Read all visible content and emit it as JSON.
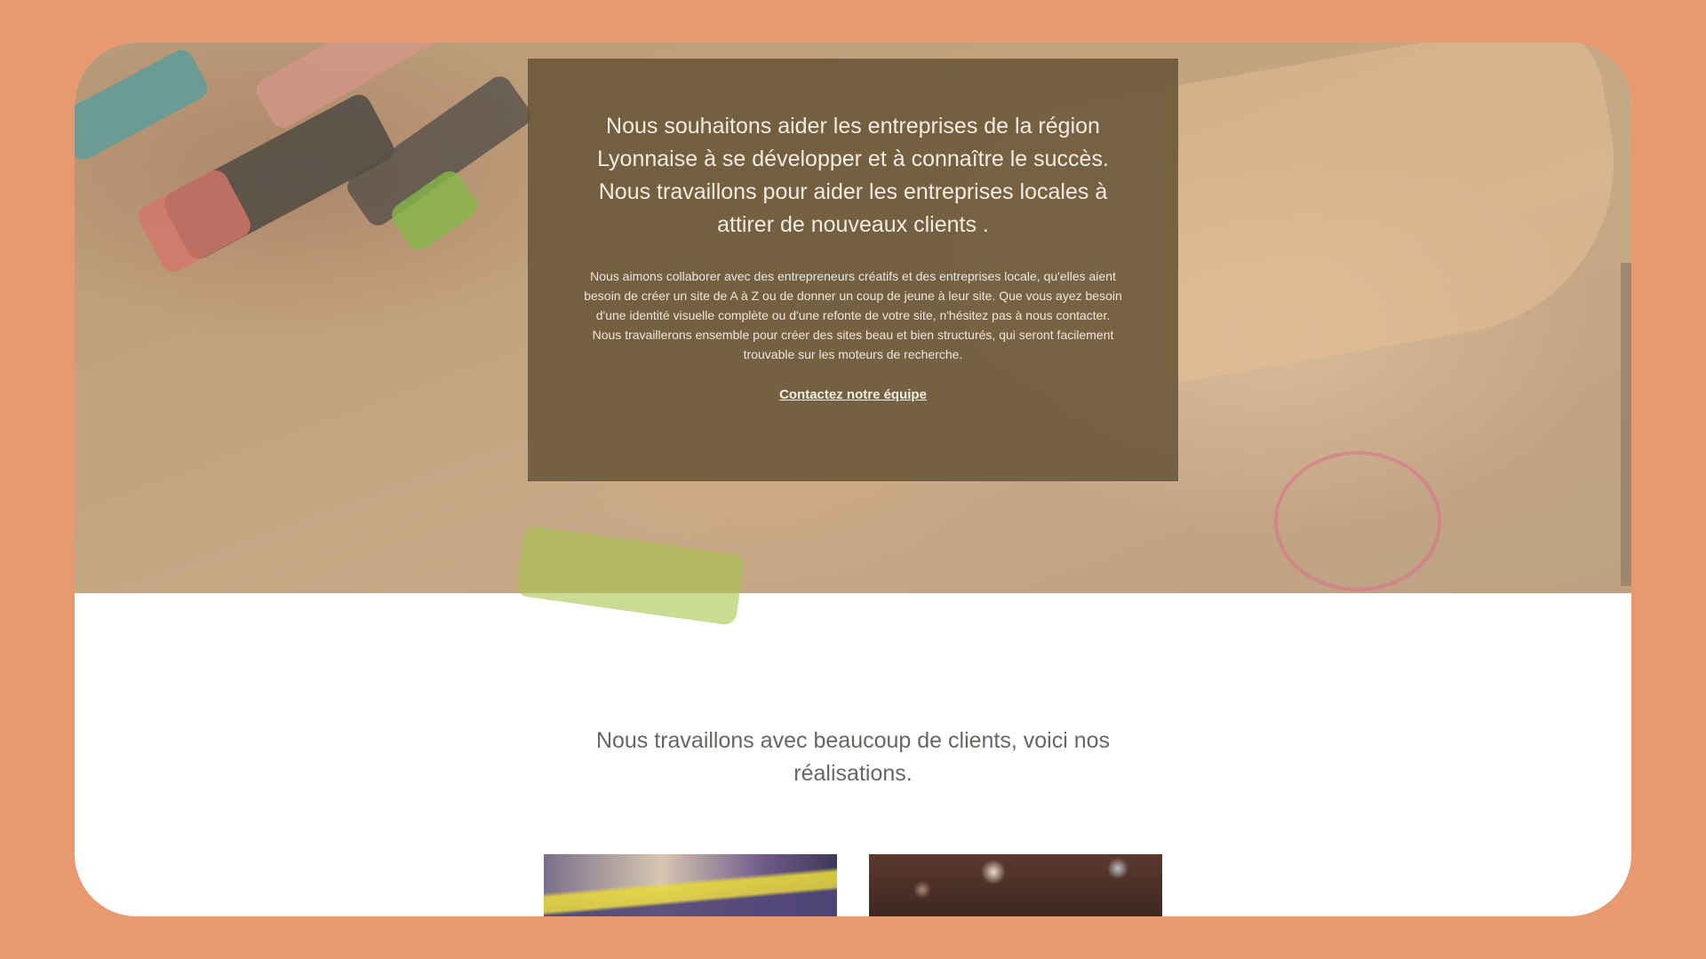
{
  "hero": {
    "headline": "Nous souhaitons aider les entreprises de la région Lyonnaise à se développer et à connaître le succès. Nous travaillons pour aider les entreprises locales à attirer de nouveaux clients .",
    "body": "Nous aimons collaborer avec des entrepreneurs créatifs et des entreprises locale, qu'elles aient besoin de créer un site de A à Z ou de donner un coup de jeune à leur site. Que vous ayez besoin d'une identité visuelle complète ou d'une refonte de votre site, n'hésitez pas à nous contacter. Nous travaillerons ensemble pour créer des sites beau et bien structurés, qui seront facilement trouvable sur les moteurs de recherche.",
    "cta_label": "Contactez notre équipe"
  },
  "clients": {
    "heading": "Nous travaillons avec beaucoup de clients, voici nos réalisations."
  },
  "colors": {
    "page_background": "#e9996f",
    "overlay": "#675437",
    "text_light": "#f2ece2"
  }
}
